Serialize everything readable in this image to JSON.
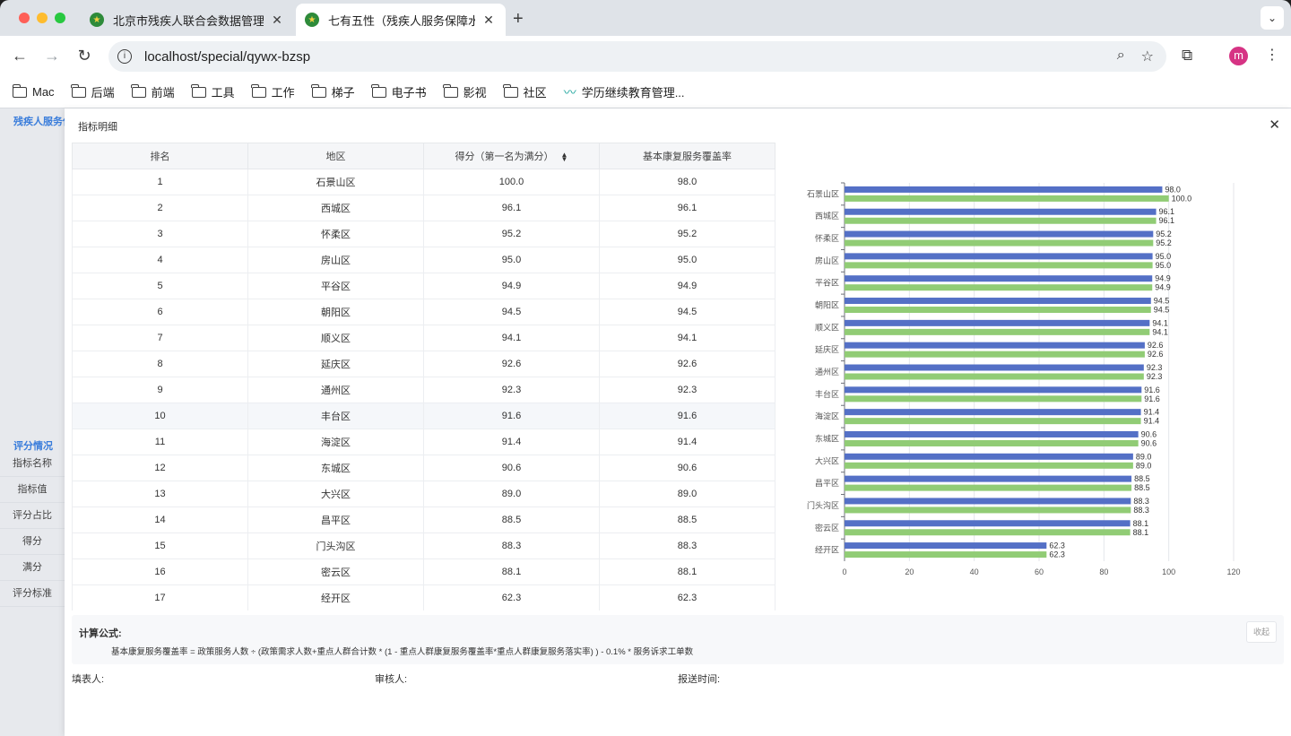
{
  "browser": {
    "tabs": [
      {
        "title": "北京市残疾人联合会数据管理平",
        "active": false
      },
      {
        "title": "七有五性（残疾人服务保障水平",
        "active": true
      }
    ],
    "url": "localhost/special/qywx-bzsp",
    "profile_initial": "m",
    "bookmarks": [
      "Mac",
      "后端",
      "前端",
      "工具",
      "工作",
      "梯子",
      "电子书",
      "影视",
      "社区",
      "学历继续教育管理..."
    ]
  },
  "sidebar": {
    "title": "残疾人服务保",
    "section": "评分情况",
    "items": [
      "指标名称",
      "指标值",
      "评分占比",
      "得分",
      "满分",
      "评分标准"
    ]
  },
  "modal": {
    "title": "指标明细",
    "columns": [
      "排名",
      "地区",
      "得分（第一名为满分）",
      "基本康复服务覆盖率"
    ],
    "rows": [
      [
        "1",
        "石景山区",
        "100.0",
        "98.0"
      ],
      [
        "2",
        "西城区",
        "96.1",
        "96.1"
      ],
      [
        "3",
        "怀柔区",
        "95.2",
        "95.2"
      ],
      [
        "4",
        "房山区",
        "95.0",
        "95.0"
      ],
      [
        "5",
        "平谷区",
        "94.9",
        "94.9"
      ],
      [
        "6",
        "朝阳区",
        "94.5",
        "94.5"
      ],
      [
        "7",
        "顺义区",
        "94.1",
        "94.1"
      ],
      [
        "8",
        "延庆区",
        "92.6",
        "92.6"
      ],
      [
        "9",
        "通州区",
        "92.3",
        "92.3"
      ],
      [
        "10",
        "丰台区",
        "91.6",
        "91.6"
      ],
      [
        "11",
        "海淀区",
        "91.4",
        "91.4"
      ],
      [
        "12",
        "东城区",
        "90.6",
        "90.6"
      ],
      [
        "13",
        "大兴区",
        "89.0",
        "89.0"
      ],
      [
        "14",
        "昌平区",
        "88.5",
        "88.5"
      ],
      [
        "15",
        "门头沟区",
        "88.3",
        "88.3"
      ],
      [
        "16",
        "密云区",
        "88.1",
        "88.1"
      ],
      [
        "17",
        "经开区",
        "62.3",
        "62.3"
      ]
    ],
    "formula_label": "计算公式:",
    "formula_text": "基本康复服务覆盖率 = 政策服务人数 ÷ (政策需求人数+重点人群合计数 * (1 - 重点人群康复服务覆盖率*重点人群康复服务落实率) ) - 0.1% * 服务诉求工单数",
    "collapse_label": "收起",
    "filler_label": "填表人:",
    "reviewer_label": "审核人:",
    "report_time_label": "报送时间:"
  },
  "chart_data": {
    "type": "bar",
    "orientation": "horizontal",
    "categories": [
      "石景山区",
      "西城区",
      "怀柔区",
      "房山区",
      "平谷区",
      "朝阳区",
      "顺义区",
      "延庆区",
      "通州区",
      "丰台区",
      "海淀区",
      "东城区",
      "大兴区",
      "昌平区",
      "门头沟区",
      "密云区",
      "经开区"
    ],
    "series": [
      {
        "color": "#5470c6",
        "values": [
          98.0,
          96.1,
          95.2,
          95.0,
          94.9,
          94.5,
          94.1,
          92.6,
          92.3,
          91.6,
          91.4,
          90.6,
          89.0,
          88.5,
          88.3,
          88.1,
          62.3
        ]
      },
      {
        "color": "#91cc75",
        "values": [
          100.0,
          96.1,
          95.2,
          95.0,
          94.9,
          94.5,
          94.1,
          92.6,
          92.3,
          91.6,
          91.4,
          90.6,
          89.0,
          88.5,
          88.3,
          88.1,
          62.3
        ]
      }
    ],
    "xlim": [
      0,
      120
    ],
    "xticks": [
      0,
      20,
      40,
      60,
      80,
      100,
      120
    ],
    "grid": "vertical"
  }
}
